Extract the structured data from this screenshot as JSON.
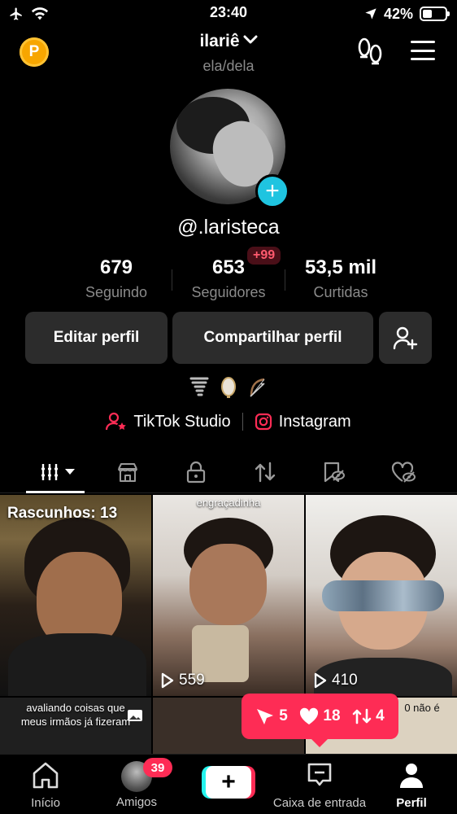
{
  "status_bar": {
    "time": "23:40",
    "battery": "42%",
    "battery_level": 0.42
  },
  "header": {
    "username": "ilariê",
    "pronouns": "ela/dela",
    "coin_letter": "P"
  },
  "profile": {
    "handle": "@.laristeca"
  },
  "stats": {
    "following": {
      "value": "679",
      "label": "Seguindo"
    },
    "followers": {
      "value": "653",
      "label": "Seguidores",
      "badge": "+99"
    },
    "likes": {
      "value": "53,5 mil",
      "label": "Curtidas"
    }
  },
  "buttons": {
    "edit": "Editar perfil",
    "share": "Compartilhar perfil"
  },
  "bio_emojis": [
    "tornado-emoji",
    "mirror-emoji",
    "bow-and-arrow-emoji"
  ],
  "links": {
    "studio": "TikTok Studio",
    "instagram": "Instagram"
  },
  "grid": {
    "drafts": "Rascunhos: 13",
    "video2_caption": "engraçadinha",
    "video2_views": "559",
    "video3_views": "410",
    "video4_caption": "avaliando coisas que meus irmãos já fizeram",
    "video6_caption": "0 não é"
  },
  "notification": {
    "followers": "5",
    "likes": "18",
    "reposts": "4"
  },
  "bottom_nav": {
    "home": "Início",
    "friends": "Amigos",
    "friends_badge": "39",
    "inbox": "Caixa de entrada",
    "profile": "Perfil"
  },
  "colors": {
    "accent": "#fe2c55",
    "cyan": "#25f4ee",
    "add_button": "#1fc4e0",
    "coin": "#f7a600"
  }
}
